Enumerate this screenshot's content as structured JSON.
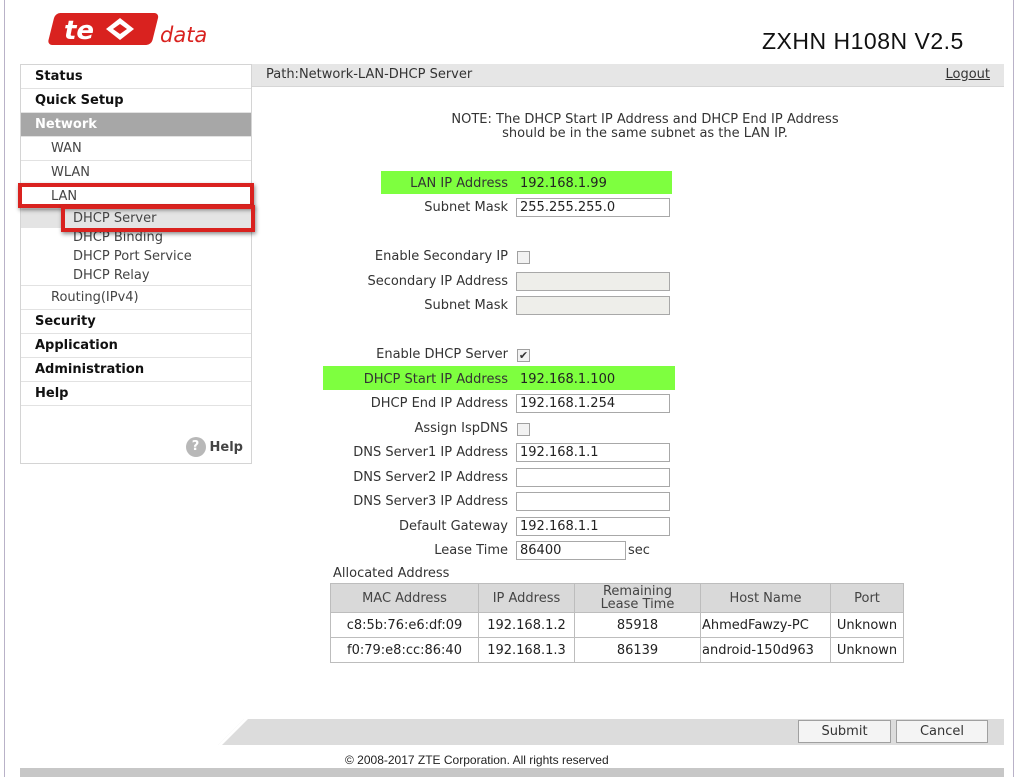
{
  "header": {
    "brand_logo_text": "te data",
    "model": "ZXHN H108N V2.5"
  },
  "sidebar": {
    "items": {
      "status": "Status",
      "quick_setup": "Quick Setup",
      "network": "Network",
      "wan": "WAN",
      "wlan": "WLAN",
      "lan": "LAN",
      "dhcp_server": "DHCP Server",
      "dhcp_binding": "DHCP Binding",
      "dhcp_port_service": "DHCP Port Service",
      "dhcp_relay": "DHCP Relay",
      "routing": "Routing(IPv4)",
      "security": "Security",
      "application": "Application",
      "administration": "Administration",
      "help": "Help"
    },
    "help_link": "Help",
    "help_icon": "?"
  },
  "path": {
    "text": "Path:Network-LAN-DHCP Server",
    "logout": "Logout"
  },
  "note": {
    "line1": "NOTE: The DHCP Start IP Address and DHCP End IP Address",
    "line2": "should be in the same subnet as the LAN IP."
  },
  "form": {
    "lan_ip_label": "LAN IP Address",
    "lan_ip_value": "192.168.1.99",
    "subnet_label": "Subnet Mask",
    "subnet_value": "255.255.255.0",
    "enable_secondary_label": "Enable Secondary IP",
    "enable_secondary_checked": false,
    "secondary_ip_label": "Secondary IP Address",
    "secondary_ip_value": "",
    "secondary_subnet_label": "Subnet Mask",
    "secondary_subnet_value": "",
    "enable_dhcp_label": "Enable DHCP Server",
    "enable_dhcp_checked": true,
    "dhcp_start_label": "DHCP Start IP Address",
    "dhcp_start_value": "192.168.1.100",
    "dhcp_end_label": "DHCP End IP Address",
    "dhcp_end_value": "192.168.1.254",
    "assign_isp_label": "Assign IspDNS",
    "assign_isp_checked": false,
    "dns1_label": "DNS Server1 IP Address",
    "dns1_value": "192.168.1.1",
    "dns2_label": "DNS Server2 IP Address",
    "dns2_value": "",
    "dns3_label": "DNS Server3 IP Address",
    "dns3_value": "",
    "gateway_label": "Default Gateway",
    "gateway_value": "192.168.1.1",
    "lease_label": "Lease Time",
    "lease_value": "86400",
    "lease_unit": "sec"
  },
  "allocated": {
    "title": "Allocated Address",
    "headers": {
      "mac": "MAC Address",
      "ip": "IP Address",
      "remaining_1": "Remaining",
      "remaining_2": "Lease Time",
      "host": "Host Name",
      "port": "Port"
    },
    "rows": [
      {
        "mac": "c8:5b:76:e6:df:09",
        "ip": "192.168.1.2",
        "remaining": "85918",
        "host": "AhmedFawzy-PC",
        "port": "Unknown"
      },
      {
        "mac": "f0:79:e8:cc:86:40",
        "ip": "192.168.1.3",
        "remaining": "86139",
        "host": "android-150d963",
        "port": "Unknown"
      }
    ]
  },
  "buttons": {
    "submit": "Submit",
    "cancel": "Cancel"
  },
  "footer": {
    "copyright": "© 2008-2017 ZTE Corporation. All rights reserved"
  },
  "colors": {
    "brand_red": "#d9221f",
    "highlight_green": "#7eff3f",
    "active_menu": "#a7a7a7"
  }
}
